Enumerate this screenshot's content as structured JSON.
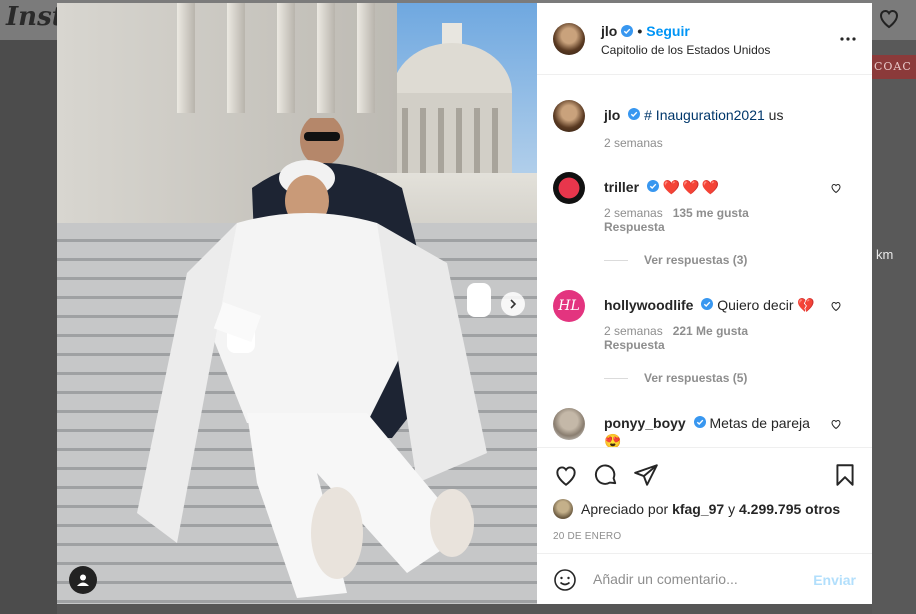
{
  "background": {
    "logo": "Insta",
    "right_ad_text": "COAC",
    "right_label": "km"
  },
  "post": {
    "header": {
      "username": "jlo",
      "follow_label": "Seguir",
      "location": "Capitolio de los Estados Unidos",
      "more_icon": "more-horizontal-icon"
    },
    "caption": {
      "username": "jlo",
      "hashtag": "# Inauguration2021",
      "suffix": " us",
      "time": "2 semanas"
    },
    "comments": [
      {
        "username": "triller",
        "text": "",
        "hearts": "❤️❤️❤️",
        "time": "2 semanas",
        "likes": "135 me gusta",
        "reply_label": "Respuesta",
        "view_replies": "Ver respuestas (3)"
      },
      {
        "username": "hollywoodlife",
        "text": "Quiero decir",
        "avatar_text": "HL",
        "time": "2 semanas",
        "likes": "221 Me gusta",
        "reply_label": "Respuesta",
        "view_replies": "Ver respuestas (5)"
      },
      {
        "username": "ponyy_boyy",
        "text": "Metas de pareja",
        "emoji": "😍"
      }
    ],
    "actions": {
      "liked_by_prefix": "Apreciado por",
      "liked_by_user": "kfag_97",
      "liked_by_and": "y",
      "liked_by_count": "4.299.795 otros",
      "date": "20 DE ENERO"
    },
    "add_comment": {
      "placeholder": "Añadir un comentario...",
      "send_label": "Enviar"
    }
  },
  "colors": {
    "accent": "#0095f6",
    "heart": "#ed4956",
    "send_disabled": "#b2dffc"
  }
}
